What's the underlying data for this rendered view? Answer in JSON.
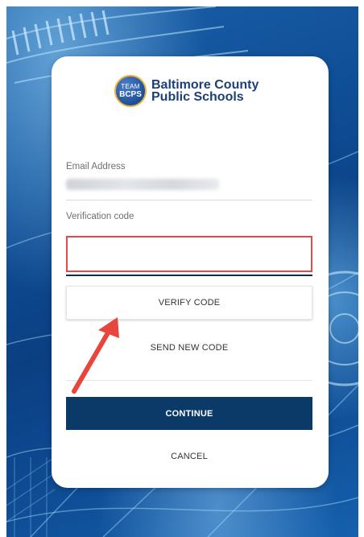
{
  "logo": {
    "badge_line1": "TEAM",
    "badge_line2": "BCPS",
    "name_line1": "Baltimore County",
    "name_line2": "Public Schools"
  },
  "form": {
    "email_label": "Email Address",
    "email_value": "",
    "code_label": "Verification code",
    "code_value": ""
  },
  "buttons": {
    "verify": "VERIFY CODE",
    "send_new": "SEND NEW CODE",
    "continue": "CONTINUE",
    "cancel": "CANCEL"
  },
  "colors": {
    "accent": "#0c3a68",
    "highlight": "#e04a4a",
    "annotation_arrow": "#e8453c"
  }
}
